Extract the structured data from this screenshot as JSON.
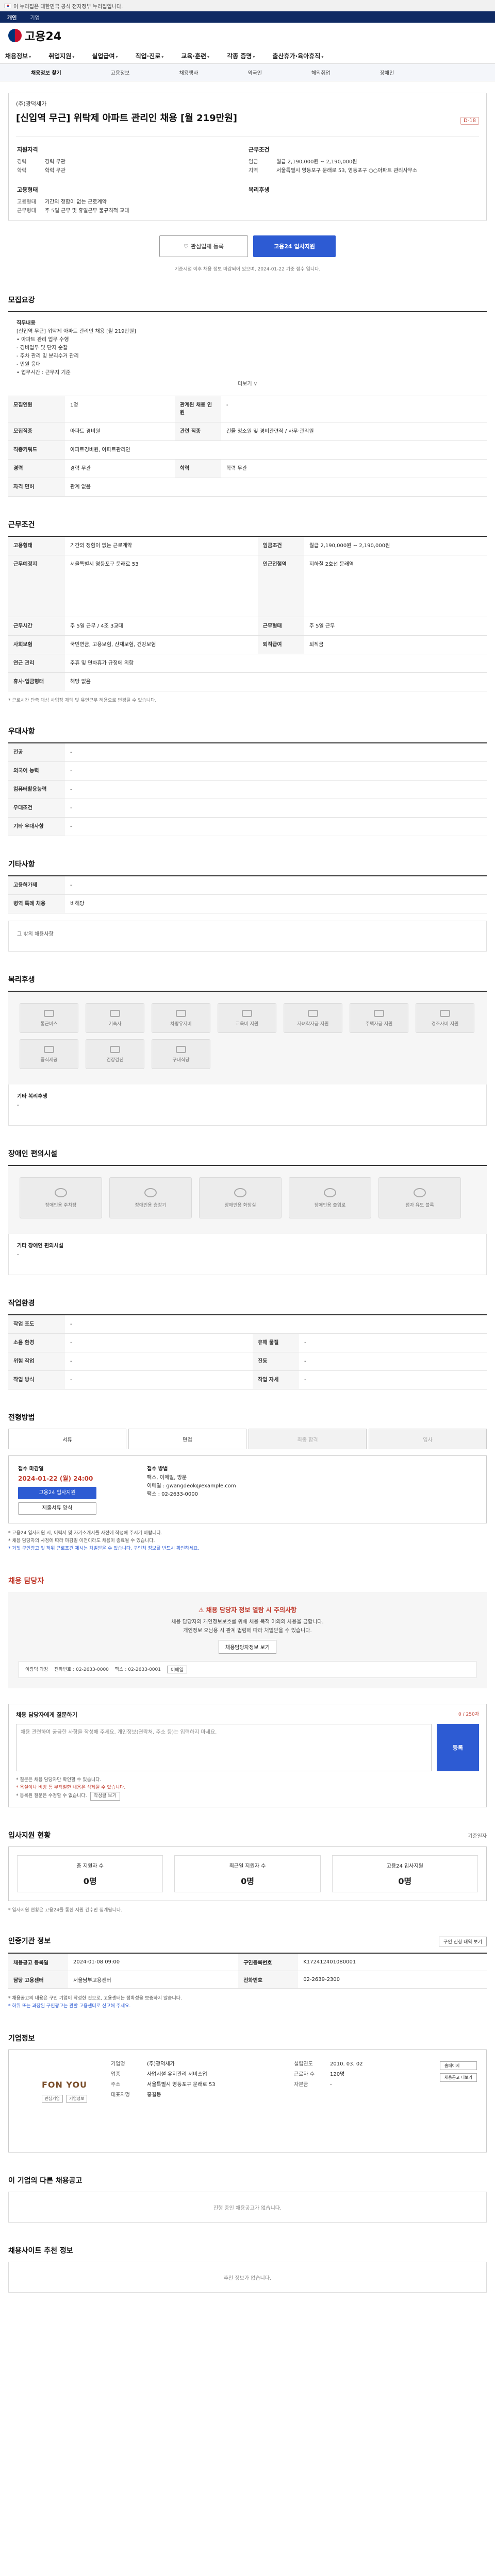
{
  "gov_bar": {
    "text": "이 누리집은 대한민국 공식 전자정부 누리집입니다."
  },
  "top_tabs": [
    "개인",
    "기업"
  ],
  "logo": {
    "text": "고용24"
  },
  "gnb": [
    "채용정보",
    "취업지원",
    "실업급여",
    "직업·진로",
    "교육·훈련",
    "각종 증명",
    "출산휴가·육아휴직"
  ],
  "subnav": [
    "채용정보 찾기",
    "고용정보",
    "채용행사",
    "외국인",
    "해외취업",
    "장애인"
  ],
  "job": {
    "company": "(주)광덕세가",
    "title": "[신입역 무근] 위탁제 아파트 관리인 채용 [월 219만원]",
    "dday": "D-18",
    "summary_left_h": "지원자격",
    "summary_left_rows": [
      [
        "경력",
        "경력 무관"
      ],
      [
        "학력",
        "학력 무관"
      ]
    ],
    "summary_right_h": "근무조건",
    "summary_right_rows": [
      [
        "임금",
        "월급 2,190,000원 ~ 2,190,000원"
      ],
      [
        "지역",
        "서울특별시 영등포구 문래로 53, 영등포구 ○○아파트 관리사무소"
      ]
    ],
    "summary_left_h2": "고용형태",
    "summary_left_rows2": [
      [
        "고용형태",
        "기간의 정함이 없는 근로계약"
      ],
      [
        "근무형태",
        "주 5일 근무 및 휴일근무 불규칙적 교대"
      ]
    ],
    "summary_right_h2": "복리후생",
    "btn_interest": "관심업체 등록",
    "btn_apply": "고용24 입사지원",
    "apply_note": "기준시점 이후 채용 정보 마감되어 있으며, 2024-01-22 기준 접수 입니다."
  },
  "duty": {
    "h": "모집요강",
    "label": "직무내용",
    "lines": [
      "[신입역 무근] 위탁제 아파트 관리인 채용 [월 219만원]",
      "• 아파트 관리 업무 수행",
      "- 경비업무 및 단지 순찰",
      "- 주차 관리 및 분리수거 관리",
      "- 민원 응대",
      "• 업무시간 : 근무지 기준"
    ],
    "more": "더보기 ∨"
  },
  "recruit_rows": [
    [
      "모집인원",
      "1명",
      "관계된 채용 인원",
      "-"
    ],
    [
      "모집직종",
      "아파트 경비원",
      "관련 직종",
      "건물 청소원 및 경비관련직 / 사무·관리원"
    ],
    [
      "직종키워드",
      "아파트경비원, 아파트관리인",
      "",
      ""
    ],
    [
      "경력",
      "경력 무관",
      "학력",
      "학력 무관"
    ],
    [
      "자격 면허",
      "관계 없음",
      "",
      ""
    ]
  ],
  "cond": {
    "h": "근무조건",
    "rows": [
      [
        "고용형태",
        "기간의 정함이 없는 근로계약",
        "임금조건",
        "월급 2,190,000원 ~ 2,190,000원"
      ],
      [
        "근무예정지",
        "서울특별시 영등포구 문래로 53",
        "인근전철역",
        "지하철 2호선 문래역"
      ],
      [
        "근무시간",
        "주 5일 근무 / 4조 3교대",
        "근무형태",
        "주 5일 근무"
      ],
      [
        "사회보험",
        "국민연금, 고용보험, 산재보험, 건강보험",
        "퇴직급여",
        "퇴직금"
      ],
      [
        "연근 관리",
        "주휴 및 연차휴가 규정에 의함",
        "",
        ""
      ],
      [
        "휴사·입금형태",
        "해당 없음",
        "",
        ""
      ]
    ],
    "note": "* 근로시간 단축 대상 사업장 재택 및 유연근무 허용으로 변경될 수 있습니다."
  },
  "prefer": {
    "h": "우대사항",
    "rows": [
      [
        "전공",
        "-"
      ],
      [
        "외국어 능력",
        "-"
      ],
      [
        "컴퓨터활용능력",
        "-"
      ],
      [
        "우대조건",
        "-"
      ],
      [
        "기타 우대사항",
        "-"
      ]
    ]
  },
  "extra": {
    "h": "기타사항",
    "rows": [
      [
        "고용허가제",
        "-"
      ],
      [
        "병역 특례 채용",
        "비해당"
      ]
    ],
    "more_label": "그 밖의 채용사항"
  },
  "welfare": {
    "h": "복리후생",
    "items": [
      "통근버스",
      "기숙사",
      "차량유지비",
      "교육비 지원",
      "자녀학자금 지원",
      "주택자금 지원",
      "경조사비 지원",
      "중식제공",
      "건강검진",
      "구내식당"
    ],
    "etc_label": "기타 복리후생",
    "etc_value": "-"
  },
  "facility": {
    "h": "장애인 편의시설",
    "items": [
      "장애인용 주차장",
      "장애인용 승강기",
      "장애인용 화장실",
      "장애인용 출입로",
      "점자 유도 블록"
    ],
    "etc_label": "기타 장애인 편의시설",
    "etc_value": "-"
  },
  "env": {
    "h": "작업환경",
    "rows": [
      [
        "작업 조도",
        "-",
        "",
        ""
      ],
      [
        "소음 환경",
        "-",
        "유해 물질",
        "-"
      ],
      [
        "위험 작업",
        "-",
        "진동",
        "-"
      ],
      [
        "작업 방식",
        "-",
        "작업 자세",
        "-"
      ]
    ]
  },
  "apply": {
    "h": "전형방법",
    "steps": [
      "서류",
      "면접",
      "최종 합격",
      "입사"
    ],
    "deadline_label": "접수 마감일",
    "deadline": "2024-01-22 (월) 24:00",
    "btn_apply": "고용24 입사지원",
    "btn_docs": "제출서류 양식",
    "method_label": "접수 방법",
    "method_lines": [
      "팩스, 이메일, 방문",
      "이메일 : gwangdeok@example.com",
      "팩스 : 02-2633-0000"
    ],
    "bullets": [
      "* 고용24 입사지원 시, 이력서 및 자기소개서를 사전에 작성해 주시기 바랍니다.",
      "* 채용 담당자의 사정에 따라 마감일 이전이라도 채용이 종료될 수 있습니다.",
      "* 거짓 구인광고 및 허위 근로조건 제시는 처벌받을 수 있습니다. 구인처 정보를 반드시 확인하세요."
    ]
  },
  "manager": {
    "h": "채용 담당자",
    "warn": "채용 담당자 정보 열람 시 주의사항",
    "p1": "채용 담당자의 개인정보보호를 위해 채용 목적 이외의 사용을 금합니다.",
    "p2": "개인정보 오남용 시 관계 법령에 따라 처벌받을 수 있습니다.",
    "btn": "채용담당자정보 보기",
    "name_line": "이광덕 과장",
    "phone": "전화번호 : 02-2633-0000",
    "fax": "팩스 : 02-2633-0001",
    "email_btn": "이메일"
  },
  "inquiry": {
    "h": "채용 담당자에게 질문하기",
    "count": "0 / 250자",
    "placeholder": "채용 관련하여 궁금한 사항을 작성해 주세요. 개인정보(연락처, 주소 등)는 입력하지 마세요.",
    "btn": "등록",
    "notes": [
      "* 질문은 채용 담당자만 확인할 수 있습니다.",
      "* 욕설이나 비방 등 부적절한 내용은 삭제될 수 있습니다.",
      "* 등록된 질문은 수정할 수 없습니다."
    ],
    "note_btn": "작성글 보기"
  },
  "status": {
    "h": "입사지원 현황",
    "side": "기준일자",
    "items": [
      [
        "총 지원자 수",
        "0명"
      ],
      [
        "최근일 지원자 수",
        "0명"
      ],
      [
        "고용24 입사지원",
        "0명"
      ]
    ],
    "note": "* 입사지원 현황은 고용24를 통한 지원 건수만 집계됩니다."
  },
  "reg": {
    "h": "인증기관 정보",
    "pill": "구인 신청 내역 보기",
    "rows": [
      [
        "채용공고 등록일",
        "2024-01-08 09:00",
        "구인등록번호",
        "K172412401080001"
      ],
      [
        "담당 고용센터",
        "서울남부고용센터",
        "전화번호",
        "02-2639-2300"
      ]
    ],
    "notes": [
      "* 채용공고의 내용은 구인 기업이 작성한 것으로, 고용센터는 정확성을 보증하지 않습니다.",
      "* 허위 또는 과장된 구인광고는 관할 고용센터로 신고해 주세요."
    ]
  },
  "company": {
    "h": "기업정보",
    "logo_text": "FON YOU",
    "logo_tags": [
      "관심기업",
      "기업정보"
    ],
    "left": [
      [
        "기업명",
        "(주)광덕세가"
      ],
      [
        "업종",
        "사업시설 유지관리 서비스업"
      ],
      [
        "주소",
        "서울특별시 영등포구 문래로 53"
      ],
      [
        "대표자명",
        "홍길동"
      ]
    ],
    "right": [
      [
        "설립연도",
        "2010. 03. 02"
      ],
      [
        "근로자 수",
        "120명"
      ],
      [
        "자본금",
        "-"
      ]
    ],
    "actions": [
      "홈페이지",
      "채용공고 더보기"
    ]
  },
  "other": {
    "h1": "이 기업의 다른 채용공고",
    "empty1": "진행 중인 채용공고가 없습니다.",
    "h2": "채용사이트 추천 정보",
    "empty2": "추천 정보가 없습니다."
  }
}
